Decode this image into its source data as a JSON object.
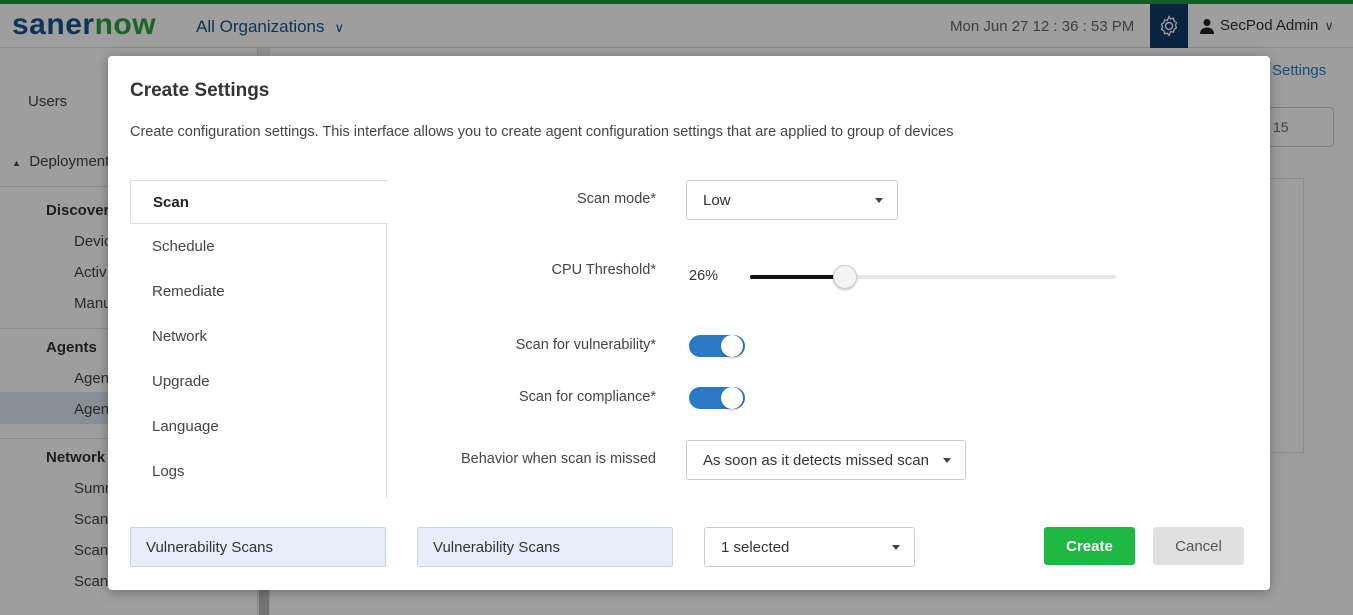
{
  "header": {
    "logo_part1": "saner",
    "logo_part2": "now",
    "org": "All Organizations",
    "datetime": "Mon Jun 27   12 : 36 : 53 PM",
    "user": "SecPod Admin"
  },
  "sidebar": {
    "users": "Users",
    "deployment": "Deployment",
    "discovery": "Discovery",
    "disc_items": [
      "Devic",
      "Activ",
      "Manu"
    ],
    "agents": "Agents",
    "agent_items": [
      "Agen",
      "Agen"
    ],
    "network": "Network",
    "net_items": [
      "Summ",
      "Scann",
      "Scan",
      "Scan"
    ]
  },
  "background": {
    "settings_link": "Settings",
    "page_size": "15"
  },
  "modal": {
    "title": "Create Settings",
    "description": "Create configuration settings. This interface allows you to create agent configuration settings that are applied to group of devices",
    "nav": [
      "Scan",
      "Schedule",
      "Remediate",
      "Network",
      "Upgrade",
      "Language",
      "Logs"
    ],
    "fields": {
      "scan_mode_label": "Scan mode*",
      "scan_mode_value": "Low",
      "cpu_label": "CPU Threshold*",
      "cpu_value_text": "26%",
      "cpu_value": 26,
      "vuln_label": "Scan for vulnerability*",
      "vuln_on": true,
      "compliance_label": "Scan for compliance*",
      "compliance_on": true,
      "missed_label": "Behavior when scan is missed",
      "missed_value": "As soon as it detects missed scan"
    },
    "footer": {
      "chip1": "Vulnerability Scans",
      "chip2": "Vulnerability Scans",
      "select": "1 selected",
      "create": "Create",
      "cancel": "Cancel"
    }
  },
  "colors": {
    "brand_blue": "#15558c",
    "brand_green": "#2aa43d",
    "toggle_on": "#2b7bc4",
    "create_button": "#1fb843"
  }
}
